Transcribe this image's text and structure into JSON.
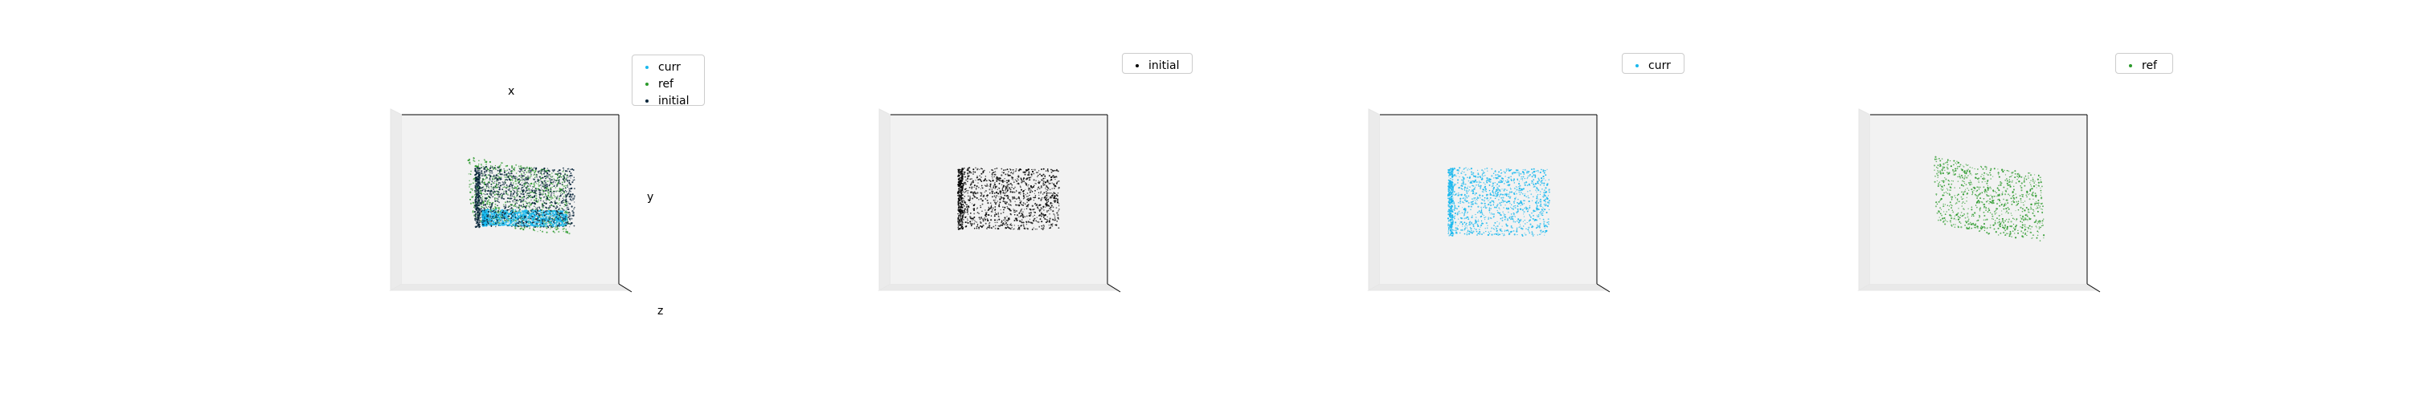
{
  "figure": {
    "background": "#ffffff",
    "pane_color": "#f2f2f2",
    "pane_edge_color": "#e6e6e6",
    "axis_line_color": "#000000"
  },
  "chart_data": [
    {
      "type": "scatter",
      "projection": "3d",
      "xlabel": "x",
      "ylabel": "y",
      "zlabel": "z",
      "grid": false,
      "axis_ticks": false,
      "legend": {
        "placement": "top-right",
        "entries": [
          "curr",
          "ref",
          "initial"
        ]
      },
      "series": [
        {
          "name": "curr",
          "color": "#1ab8ee",
          "shape": "box",
          "center": [
            0.24,
            0.08,
            0.0
          ],
          "extent": [
            0.6,
            0.42,
            0.25
          ]
        },
        {
          "name": "ref",
          "color": "#2c9a2c",
          "shape": "sheet",
          "center": [
            0.0,
            -0.03,
            0.0
          ],
          "extent": [
            0.62,
            0.4,
            0.05
          ]
        },
        {
          "name": "initial",
          "color": "#08253a",
          "shape": "box",
          "center": [
            0.0,
            -0.02,
            0.0
          ],
          "extent": [
            0.6,
            0.38,
            0.25
          ]
        }
      ]
    },
    {
      "type": "scatter",
      "projection": "3d",
      "grid": false,
      "axis_ticks": false,
      "legend": {
        "placement": "top-right",
        "entries": [
          "initial"
        ]
      },
      "series": [
        {
          "name": "initial",
          "color": "#000000",
          "shape": "box",
          "center": [
            0.0,
            0.0,
            0.0
          ],
          "extent": [
            0.6,
            0.38,
            0.25
          ]
        }
      ]
    },
    {
      "type": "scatter",
      "projection": "3d",
      "grid": false,
      "axis_ticks": false,
      "legend": {
        "placement": "top-right",
        "entries": [
          "curr"
        ]
      },
      "series": [
        {
          "name": "curr",
          "color": "#1ab8ee",
          "shape": "box",
          "center": [
            0.0,
            0.0,
            0.0
          ],
          "extent": [
            0.6,
            0.42,
            0.25
          ]
        }
      ]
    },
    {
      "type": "scatter",
      "projection": "3d",
      "grid": false,
      "axis_ticks": false,
      "legend": {
        "placement": "top-right",
        "entries": [
          "ref"
        ]
      },
      "series": [
        {
          "name": "ref",
          "color": "#2c9a2c",
          "shape": "sheet",
          "center": [
            0.0,
            0.0,
            0.0
          ],
          "extent": [
            0.64,
            0.4,
            0.05
          ]
        }
      ]
    }
  ]
}
